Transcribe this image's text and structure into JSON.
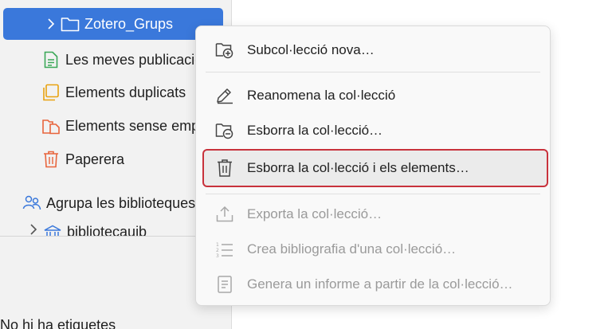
{
  "collections": {
    "selected": {
      "label": "Zotero_Grups"
    },
    "items": [
      {
        "label": "Les meves publicacions"
      },
      {
        "label": "Elements duplicats"
      },
      {
        "label": "Elements sense emplenar"
      },
      {
        "label": "Paperera"
      }
    ],
    "group_section": {
      "label": "Agrupa les biblioteques"
    },
    "library": {
      "label": "bibliotecauib"
    }
  },
  "tags_pane": {
    "label": "No hi ha etiquetes"
  },
  "context_menu": {
    "items": [
      {
        "label": "Subcol·lecció nova…",
        "enabled": true
      },
      {
        "label": "Reanomena la col·lecció",
        "enabled": true
      },
      {
        "label": "Esborra la col·lecció…",
        "enabled": true
      },
      {
        "label": "Esborra la col·lecció i els elements…",
        "enabled": true,
        "highlighted": true
      },
      {
        "label": "Exporta la col·lecció…",
        "enabled": false
      },
      {
        "label": "Crea bibliografia d'una col·lecció…",
        "enabled": false
      },
      {
        "label": "Genera un informe a partir de la col·lecció…",
        "enabled": false
      }
    ]
  },
  "colors": {
    "selection": "#3a78db",
    "highlight_border": "#c8323c",
    "green_icon": "#3aa757",
    "orange_icon": "#e8a20f",
    "red_icon": "#e8643c",
    "blue_icon": "#3a78db"
  },
  "icons": {
    "selected": "folder-icon",
    "my_publications": "document-icon",
    "duplicates": "duplicate-icon",
    "unfiled": "unfiled-icon",
    "trash": "trash-icon",
    "group": "group-icon",
    "library": "library-icon"
  }
}
